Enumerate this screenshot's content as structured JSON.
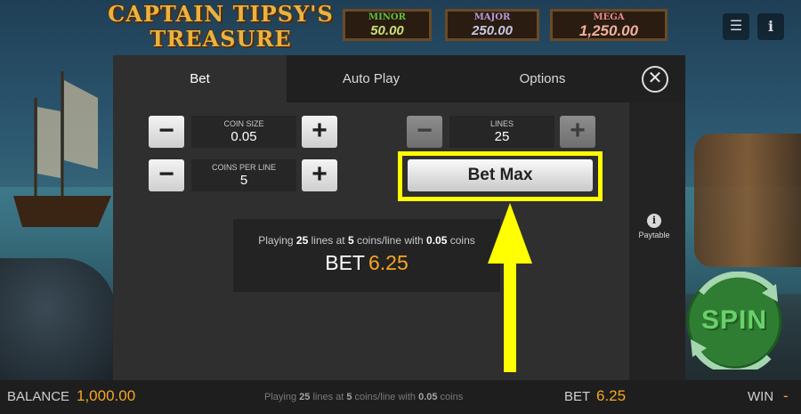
{
  "header": {
    "logo_line1": "CAPTAIN TIPSY'S",
    "logo_line2": "TREASURE",
    "jackpots": [
      {
        "label": "MINOR",
        "value": "50.00"
      },
      {
        "label": "MAJOR",
        "value": "250.00"
      },
      {
        "label": "MEGA",
        "value": "1,250.00"
      }
    ],
    "menu_icon": "hamburger-menu-icon",
    "info_icon": "info-icon",
    "menu_glyph": "☰",
    "info_glyph": "i"
  },
  "modal": {
    "tabs": [
      {
        "label": "Bet",
        "active": true
      },
      {
        "label": "Auto Play",
        "active": false
      },
      {
        "label": "Options",
        "active": false
      }
    ],
    "close_glyph": "✕",
    "coin_size": {
      "label": "COIN SIZE",
      "value": "0.05"
    },
    "coins_per_line": {
      "label": "COINS PER LINE",
      "value": "5"
    },
    "lines": {
      "label": "LINES",
      "value": "25"
    },
    "minus_glyph": "−",
    "plus_glyph": "+",
    "bet_max_label": "Bet Max",
    "summary": {
      "prefix": "Playing ",
      "lines": "25",
      "middle1": " lines at ",
      "coins": "5",
      "middle2": " coins/line with ",
      "coin_size": "0.05",
      "suffix": " coins",
      "bet_label": "BET",
      "bet_value": "6.25"
    },
    "paytable_label": "Paytable",
    "paytable_glyph": "i"
  },
  "spin_label": "SPIN",
  "bottom": {
    "balance_label": "BALANCE",
    "balance_value": "1,000.00",
    "playing_prefix": "Playing ",
    "playing_lines": "25",
    "playing_mid1": " lines at ",
    "playing_coins": "5",
    "playing_mid2": " coins/line with ",
    "playing_coin_size": "0.05",
    "playing_suffix": " coins",
    "bet_label": "BET",
    "bet_value": "6.25",
    "win_label": "WIN",
    "win_value": "-"
  },
  "colors": {
    "accent": "#f5a623",
    "highlight": "#ffff00"
  }
}
